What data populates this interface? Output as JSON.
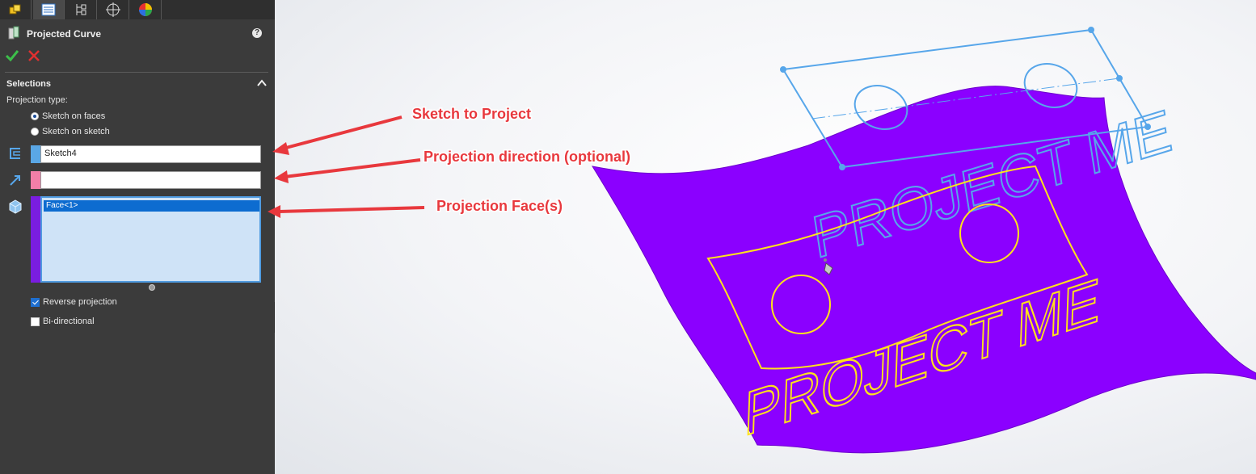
{
  "panel": {
    "title": "Projected Curve",
    "help_icon": "?",
    "tabs": [
      "feature-manager-icon",
      "property-manager-icon",
      "configuration-manager-icon",
      "dimxpert-icon",
      "display-manager-icon"
    ],
    "selections": {
      "section_title": "Selections",
      "projection_type_label": "Projection type:",
      "options": [
        "Sketch on faces",
        "Sketch on sketch"
      ],
      "selected_option": "Sketch on faces",
      "sketch_field": "Sketch4",
      "direction_field": "",
      "faces": [
        "Face<1>"
      ]
    },
    "options": {
      "reverse_projection": "Reverse projection",
      "reverse_checked": true,
      "bidirectional": "Bi-directional",
      "bidirectional_checked": false
    },
    "colors": {
      "sketch_swatch": "#5aa7e6",
      "direction_swatch": "#f27fa8",
      "face_swatch": "#7a1de0"
    }
  },
  "annotations": {
    "sketch": "Sketch to Project",
    "direction": "Projection direction (optional)",
    "face": "Projection Face(s)"
  },
  "graphics": {
    "surface_color": "#8b00ff",
    "sketch_color": "#57a6ea",
    "projected_color": "#ffe21a",
    "sketch_text": "PROJECT ME",
    "projected_text": "PROJECT ME"
  }
}
